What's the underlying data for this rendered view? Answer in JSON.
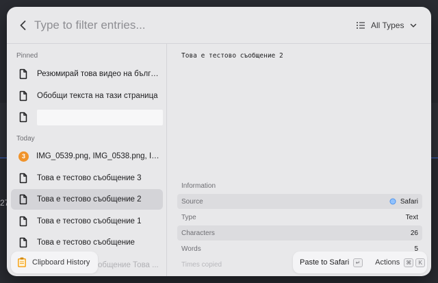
{
  "background": {
    "number_fragment": "27"
  },
  "search": {
    "placeholder": "Type to filter entries...",
    "filter_label": "All Types"
  },
  "sections": {
    "pinned": "Pinned",
    "today": "Today"
  },
  "pinned_items": [
    {
      "label": "Резюмирай това видео на българ...",
      "icon": "document-icon"
    },
    {
      "label": "Обобщи текста на тази страница",
      "icon": "document-icon"
    },
    {
      "label": "",
      "icon": "document-icon"
    }
  ],
  "today_items": [
    {
      "label": "IMG_0539.png, IMG_0538.png, IM...",
      "badge": "3"
    },
    {
      "label": "Това е тестово съобщение 3",
      "icon": "document-icon"
    },
    {
      "label": "Това е тестово съобщение 2",
      "icon": "document-icon",
      "selected": true
    },
    {
      "label": "Това е тестово съобщение 1",
      "icon": "document-icon"
    },
    {
      "label": "Това е тестово съобщение",
      "icon": "document-icon"
    }
  ],
  "ghost_item": "обобщение Това ...",
  "preview": {
    "text": "Това е тестово съобщение 2"
  },
  "information": {
    "title": "Information",
    "rows": [
      {
        "key": "Source",
        "value": "Safari"
      },
      {
        "key": "Type",
        "value": "Text"
      },
      {
        "key": "Characters",
        "value": "26"
      },
      {
        "key": "Words",
        "value": "5"
      },
      {
        "key": "Times copied",
        "value": ""
      }
    ]
  },
  "footer": {
    "app_label": "Clipboard History",
    "paste_label": "Paste to Safari",
    "paste_key": "↵",
    "actions_label": "Actions",
    "actions_key_1": "⌘",
    "actions_key_2": "K"
  },
  "colors": {
    "badge": "#f0932b",
    "selected_row": "#d4d4d8",
    "panel": "#e8e8ea"
  }
}
